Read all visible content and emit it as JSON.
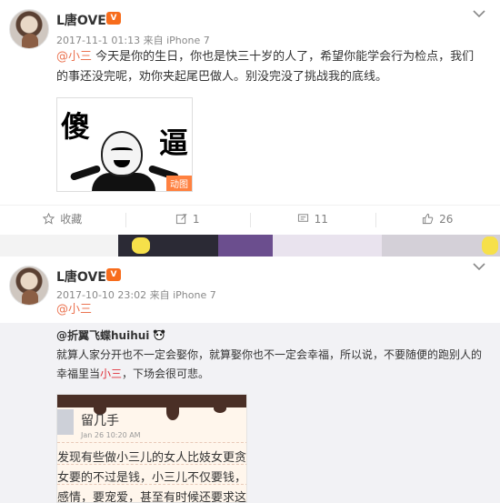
{
  "post1": {
    "username": "L唐OVE",
    "badge": "vip",
    "timestamp": "2017-11-1 01:13",
    "source": "来自 iPhone 7",
    "mention": "@小三",
    "body": " 今天是你的生日，你也是快三十岁的人了，希望你能学会行为检点，我们的事还没完呢，劝你夹起尾巴做人。别没完没了挑战我的底线。",
    "image": {
      "word_left": "傻",
      "word_right": "逼",
      "gif_tag": "动图"
    },
    "actions": {
      "favorite": "收藏",
      "repost_count": "1",
      "comment_count": "11",
      "like_count": "26"
    }
  },
  "post2": {
    "username": "L唐OVE",
    "timestamp": "2017-10-10 23:02",
    "source": "来自 iPhone 7",
    "mention": "@小三",
    "repost": {
      "author": "@折翼飞蝶huihui",
      "text_part1": "就算人家分开也不一定会娶你，就算娶你也不一定会幸福，所以说，不要随便的跑别人的幸福里当",
      "highlight": "小三",
      "text_part2": "，下场会很可悲。",
      "screenshot": {
        "title": "留几手",
        "date": "Jan 26 10:20 AM",
        "lines": [
          "发现有些做小三儿的女人比妓女更贪",
          "女要的不过是钱，小三儿不仅要钱，还",
          "感情，要宠爱，甚至有时候还要求这"
        ]
      }
    }
  },
  "colors": {
    "accent": "#eb7350",
    "highlight": "#e0303a",
    "repost_bg": "#f2f2f5"
  },
  "icons": [
    "chevron-down-icon",
    "star-icon",
    "repost-icon",
    "comment-icon",
    "like-icon",
    "panda-icon"
  ]
}
